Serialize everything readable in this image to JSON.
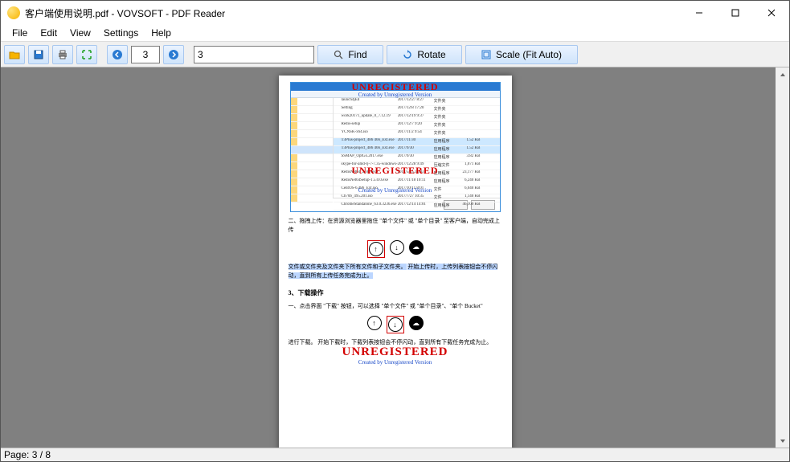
{
  "title": "客户端使用说明.pdf - VOVSOFT - PDF Reader",
  "menu": {
    "file": "File",
    "edit": "Edit",
    "view": "View",
    "settings": "Settings",
    "help": "Help"
  },
  "toolbar": {
    "page_value": "3",
    "find_value": "3",
    "find_label": "Find",
    "rotate_label": "Rotate",
    "scale_label": "Scale (Fit Auto)"
  },
  "status": "Page: 3 / 8",
  "doc": {
    "watermark": "UNREGISTERED",
    "watermark_sub": "Created by Unregistered Version",
    "para1_a": "二、拖拽上传：在资源浏览器里拖住 \"单个文件\" 或 \"单个目录\" 至客户端，自动完成上传",
    "para1_hl": "文件或文件夹及文件夹下所有文件和子文件夹。",
    "para1_b": "开始上传时，上传列表按钮会不停闪动，直到所有上传任务完成为止。",
    "sec3": "3、下载操作",
    "para3": "一、点击界面 \"下载\" 按钮，可以选择 \"单个文件\" 或 \"单个目录\"、\"单个 Bucket\"",
    "para4_a": "进行下载。",
    "para4_b": "开始下载时，下载列表按钮会不停闪动，直到所有下载任务完成为止。",
    "filelist": [
      {
        "n": "launch4jEd",
        "d": "2017/12/27 8:27",
        "t": "文件夹",
        "s": ""
      },
      {
        "n": "Setting",
        "d": "2017/12/8 17:20",
        "t": "文件夹",
        "s": ""
      },
      {
        "n": "work20171_update_0_7.12.19",
        "d": "2017/12/19 9:37",
        "t": "文件夹",
        "s": ""
      },
      {
        "n": "Redis-setup",
        "d": "2017/12/7 9:20",
        "t": "文件夹",
        "s": ""
      },
      {
        "n": "YCNSK-x64.iso",
        "d": "2017/11/2 9:54",
        "t": "文件夹",
        "s": ""
      },
      {
        "n": "T3Plus-project_486 466_Ext.exe",
        "d": "2017/11/30",
        "t": "应用程序",
        "s": "1.52 KB"
      },
      {
        "n": "T3Plus-project_486 466_Ext.exe",
        "d": "2017/9/30",
        "t": "应用程序",
        "s": "1.52 KB"
      },
      {
        "n": "SSMAP_OptGo.2017.exe",
        "d": "2017/9/30",
        "t": "应用程序",
        "s": "3.82 KB"
      },
      {
        "n": "skype-for-amd-rj-7-7.35-windows-x64.zip",
        "d": "2017/12/28 9:49",
        "t": "压缩文件",
        "s": "1,071 KB"
      },
      {
        "n": "RedisNet64_2_8.7.exe",
        "d": "2017/5/15 15:03",
        "t": "应用程序",
        "s": "23,177 KB"
      },
      {
        "n": "RedisNet64Setup-1.5.0.0.exe",
        "d": "2017/11/18 10:11",
        "t": "应用程序",
        "s": "6,240 KB"
      },
      {
        "n": "CentOS-6.486_Ext.iso",
        "d": "2017/10/11 8:01",
        "t": "文件",
        "s": "6,040 KB"
      },
      {
        "n": "Cb70b_495.201.iso",
        "d": "2017/7/27 10:35",
        "t": "文件",
        "s": "1,140 KB"
      },
      {
        "n": "ChromeStandalone_63.0.3236.exe",
        "d": "2017/12/14 14:01",
        "t": "应用程序",
        "s": "46,109 KB"
      }
    ]
  }
}
